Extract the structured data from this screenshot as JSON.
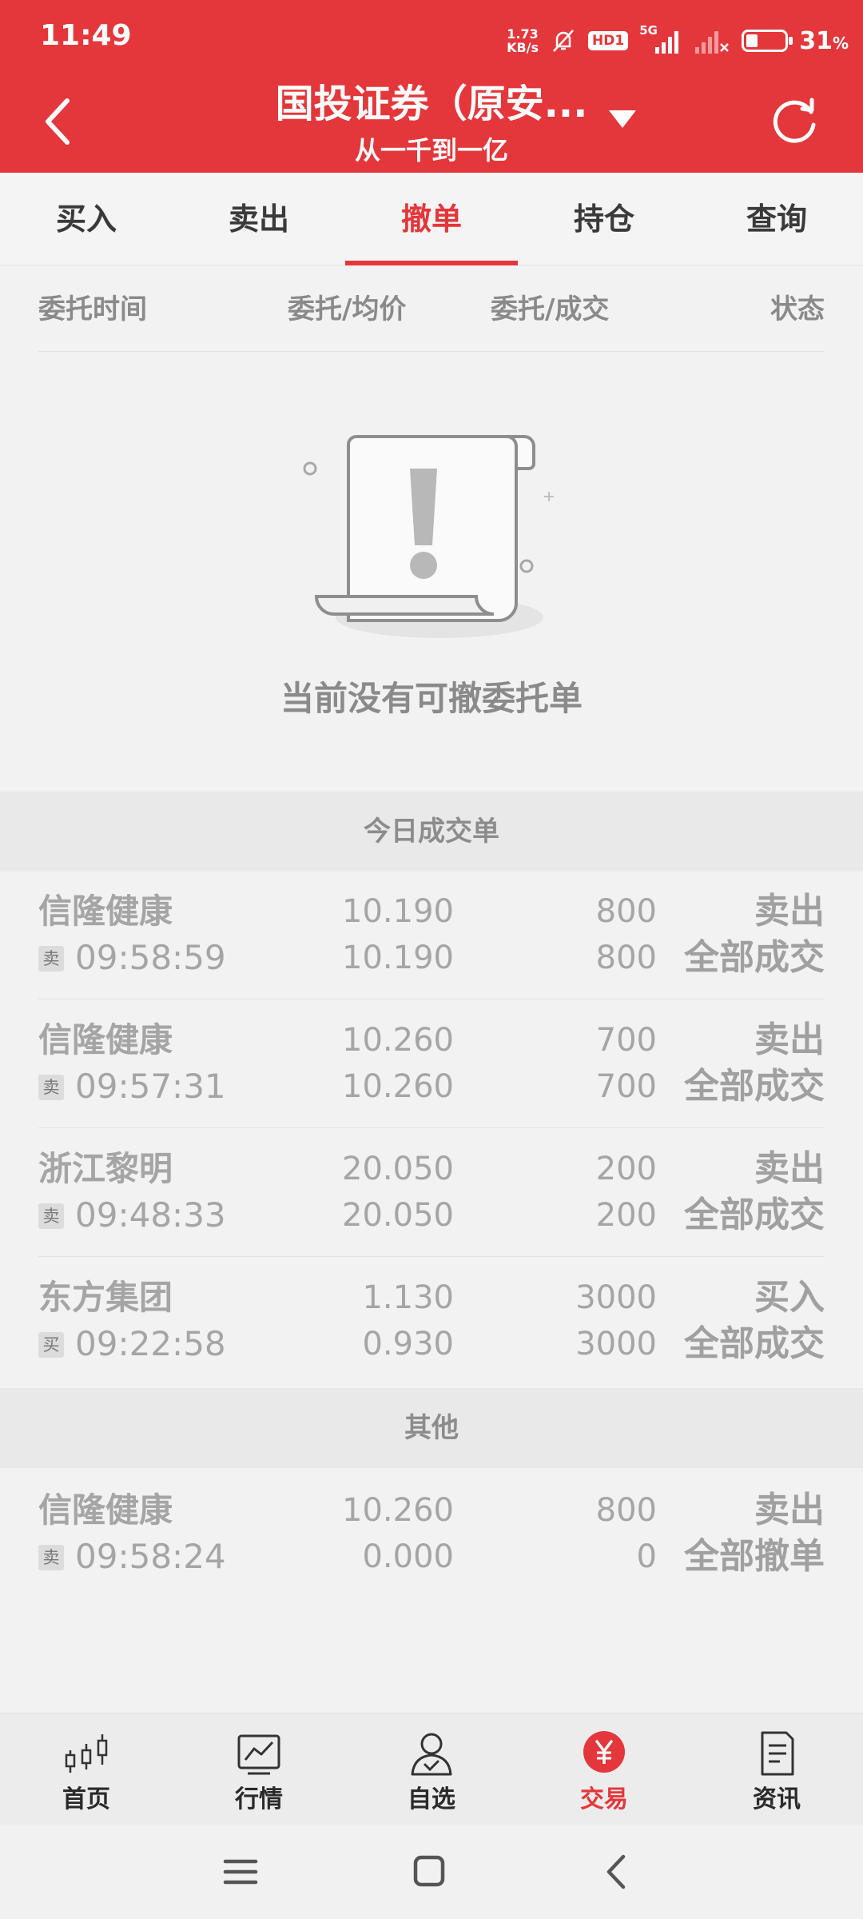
{
  "status_bar": {
    "time": "11:49",
    "net_speed_value": "1.73",
    "net_speed_unit": "KB/s",
    "hd_badge": "HD1",
    "network": "5G",
    "battery": "31",
    "battery_unit": "%"
  },
  "header": {
    "title": "国投证券（原安...",
    "subtitle": "从一千到一亿",
    "accent_color": "#e4373b"
  },
  "tabs": [
    {
      "label": "买入",
      "active": false
    },
    {
      "label": "卖出",
      "active": false
    },
    {
      "label": "撤单",
      "active": true
    },
    {
      "label": "持仓",
      "active": false
    },
    {
      "label": "查询",
      "active": false
    }
  ],
  "columns": {
    "time": "委托时间",
    "price": "委托/均价",
    "qty": "委托/成交",
    "status": "状态"
  },
  "empty_state": {
    "message": "当前没有可撤委托单",
    "icon": "empty-scroll-icon"
  },
  "sections": {
    "today": "今日成交单",
    "other": "其他"
  },
  "today_orders": [
    {
      "name": "信隆健康",
      "side_tag": "卖",
      "time": "09:58:59",
      "order_price": "10.190",
      "avg_price": "10.190",
      "order_qty": "800",
      "filled_qty": "800",
      "direction": "卖出",
      "status": "全部成交"
    },
    {
      "name": "信隆健康",
      "side_tag": "卖",
      "time": "09:57:31",
      "order_price": "10.260",
      "avg_price": "10.260",
      "order_qty": "700",
      "filled_qty": "700",
      "direction": "卖出",
      "status": "全部成交"
    },
    {
      "name": "浙江黎明",
      "side_tag": "卖",
      "time": "09:48:33",
      "order_price": "20.050",
      "avg_price": "20.050",
      "order_qty": "200",
      "filled_qty": "200",
      "direction": "卖出",
      "status": "全部成交"
    },
    {
      "name": "东方集团",
      "side_tag": "买",
      "time": "09:22:58",
      "order_price": "1.130",
      "avg_price": "0.930",
      "order_qty": "3000",
      "filled_qty": "3000",
      "direction": "买入",
      "status": "全部成交"
    }
  ],
  "other_orders": [
    {
      "name": "信隆健康",
      "side_tag": "卖",
      "time": "09:58:24",
      "order_price": "10.260",
      "avg_price": "0.000",
      "order_qty": "800",
      "filled_qty": "0",
      "direction": "卖出",
      "status": "全部撤单"
    }
  ],
  "bottom_nav": [
    {
      "label": "首页",
      "icon": "candlestick-icon",
      "active": false
    },
    {
      "label": "行情",
      "icon": "market-chart-icon",
      "active": false
    },
    {
      "label": "自选",
      "icon": "person-check-icon",
      "active": false
    },
    {
      "label": "交易",
      "icon": "yuan-icon",
      "active": true
    },
    {
      "label": "资讯",
      "icon": "document-icon",
      "active": false
    }
  ]
}
